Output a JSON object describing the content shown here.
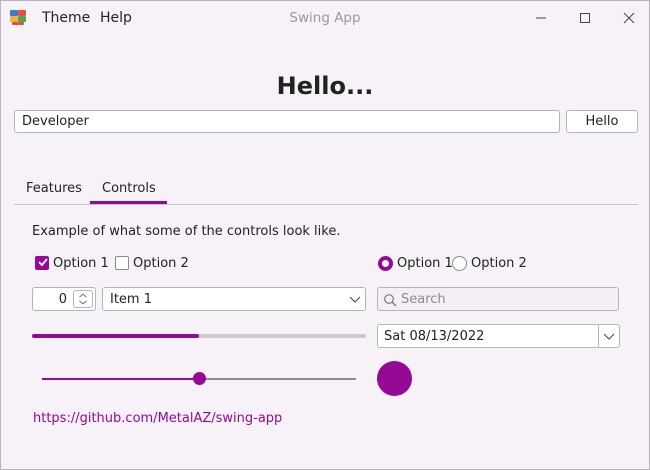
{
  "window": {
    "title": "Swing App",
    "menu": [
      "Theme",
      "Help"
    ],
    "icon": "swing-app-icon",
    "controls": [
      "minimize-icon",
      "maximize-icon",
      "close-icon"
    ]
  },
  "greeting": {
    "title": "Hello...",
    "name_value": "Developer",
    "button_label": "Hello"
  },
  "tabs": [
    {
      "label": "Features",
      "selected": false
    },
    {
      "label": "Controls",
      "selected": true
    }
  ],
  "controls_panel": {
    "description": "Example of what some of the controls look like.",
    "checkboxes": [
      {
        "label": "Option 1",
        "checked": true
      },
      {
        "label": "Option 2",
        "checked": false
      }
    ],
    "radios": [
      {
        "label": "Option 1",
        "checked": true
      },
      {
        "label": "Option 2",
        "checked": false
      }
    ],
    "spinner_value": "0",
    "combo_value": "Item 1",
    "search_placeholder": "Search",
    "progress_fraction": 0.5,
    "date_value": "Sat 08/13/2022",
    "slider_fraction": 0.5,
    "link": "https://github.com/MetalAZ/swing-app"
  },
  "colors": {
    "accent": "#960896",
    "background": "#f6f2f7",
    "text": "#222222"
  }
}
